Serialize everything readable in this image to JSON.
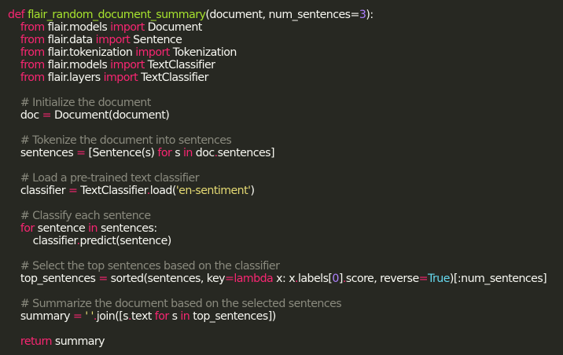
{
  "code": {
    "theme": {
      "background": "#272822",
      "foreground": "#f8f8f2",
      "keyword": "#f92672",
      "function": "#a6e22e",
      "string": "#e6db74",
      "number": "#ae81ff",
      "comment": "#8a8a7e",
      "builtin": "#66d9ef"
    },
    "lines": [
      [
        [
          "kw",
          "def"
        ],
        [
          "pl",
          " "
        ],
        [
          "fn",
          "flair_random_document_summary"
        ],
        [
          "pl",
          "(document, num_sentences="
        ],
        [
          "num",
          "3"
        ],
        [
          "pl",
          "):"
        ]
      ],
      [
        [
          "pl",
          "    "
        ],
        [
          "kw",
          "from"
        ],
        [
          "pl",
          " flair.models "
        ],
        [
          "kw",
          "import"
        ],
        [
          "pl",
          " Document"
        ]
      ],
      [
        [
          "pl",
          "    "
        ],
        [
          "kw",
          "from"
        ],
        [
          "pl",
          " flair.data "
        ],
        [
          "kw",
          "import"
        ],
        [
          "pl",
          " Sentence"
        ]
      ],
      [
        [
          "pl",
          "    "
        ],
        [
          "kw",
          "from"
        ],
        [
          "pl",
          " flair.tokenization "
        ],
        [
          "kw",
          "import"
        ],
        [
          "pl",
          " Tokenization"
        ]
      ],
      [
        [
          "pl",
          "    "
        ],
        [
          "kw",
          "from"
        ],
        [
          "pl",
          " flair.models "
        ],
        [
          "kw",
          "import"
        ],
        [
          "pl",
          " TextClassifier"
        ]
      ],
      [
        [
          "pl",
          "    "
        ],
        [
          "kw",
          "from"
        ],
        [
          "pl",
          " flair.layers "
        ],
        [
          "kw",
          "import"
        ],
        [
          "pl",
          " TextClassifier"
        ]
      ],
      [],
      [
        [
          "pl",
          "    "
        ],
        [
          "cm",
          "# Initialize the document"
        ]
      ],
      [
        [
          "pl",
          "    doc "
        ],
        [
          "kw",
          "="
        ],
        [
          "pl",
          " Document(document)"
        ]
      ],
      [],
      [
        [
          "pl",
          "    "
        ],
        [
          "cm",
          "# Tokenize the document into sentences"
        ]
      ],
      [
        [
          "pl",
          "    sentences "
        ],
        [
          "kw",
          "="
        ],
        [
          "pl",
          " [Sentence(s) "
        ],
        [
          "kw",
          "for"
        ],
        [
          "pl",
          " s "
        ],
        [
          "kw",
          "in"
        ],
        [
          "pl",
          " doc"
        ],
        [
          "kw",
          "."
        ],
        [
          "pl",
          "sentences]"
        ]
      ],
      [],
      [
        [
          "pl",
          "    "
        ],
        [
          "cm",
          "# Load a pre-trained text classifier"
        ]
      ],
      [
        [
          "pl",
          "    classifier "
        ],
        [
          "kw",
          "="
        ],
        [
          "pl",
          " TextClassifier"
        ],
        [
          "kw",
          "."
        ],
        [
          "pl",
          "load("
        ],
        [
          "str",
          "'en-sentiment'"
        ],
        [
          "pl",
          ")"
        ]
      ],
      [],
      [
        [
          "pl",
          "    "
        ],
        [
          "cm",
          "# Classify each sentence"
        ]
      ],
      [
        [
          "pl",
          "    "
        ],
        [
          "kw",
          "for"
        ],
        [
          "pl",
          " sentence "
        ],
        [
          "kw",
          "in"
        ],
        [
          "pl",
          " sentences:"
        ]
      ],
      [
        [
          "pl",
          "        classifier"
        ],
        [
          "kw",
          "."
        ],
        [
          "pl",
          "predict(sentence)"
        ]
      ],
      [],
      [
        [
          "pl",
          "    "
        ],
        [
          "cm",
          "# Select the top sentences based on the classifier"
        ]
      ],
      [
        [
          "pl",
          "    top_sentences "
        ],
        [
          "kw",
          "="
        ],
        [
          "pl",
          " sorted(sentences, key"
        ],
        [
          "kw",
          "="
        ],
        [
          "kw",
          "lambda"
        ],
        [
          "pl",
          " x: x"
        ],
        [
          "kw",
          "."
        ],
        [
          "pl",
          "labels["
        ],
        [
          "num",
          "0"
        ],
        [
          "pl",
          "]"
        ],
        [
          "kw",
          "."
        ],
        [
          "pl",
          "score, reverse"
        ],
        [
          "kw",
          "="
        ],
        [
          "bi",
          "True"
        ],
        [
          "pl",
          ")[:num_sentences]"
        ]
      ],
      [],
      [
        [
          "pl",
          "    "
        ],
        [
          "cm",
          "# Summarize the document based on the selected sentences"
        ]
      ],
      [
        [
          "pl",
          "    summary "
        ],
        [
          "kw",
          "="
        ],
        [
          "pl",
          " "
        ],
        [
          "str",
          "' '"
        ],
        [
          "kw",
          "."
        ],
        [
          "pl",
          "join([s"
        ],
        [
          "kw",
          "."
        ],
        [
          "pl",
          "text "
        ],
        [
          "kw",
          "for"
        ],
        [
          "pl",
          " s "
        ],
        [
          "kw",
          "in"
        ],
        [
          "pl",
          " top_sentences])"
        ]
      ],
      [],
      [
        [
          "pl",
          "    "
        ],
        [
          "kw",
          "return"
        ],
        [
          "pl",
          " summary"
        ]
      ]
    ]
  }
}
